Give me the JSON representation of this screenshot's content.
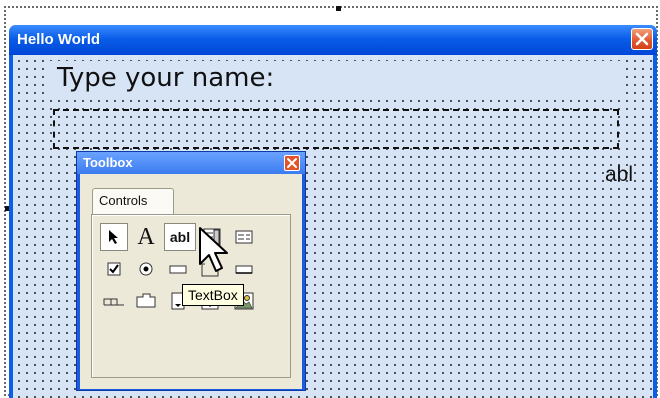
{
  "form": {
    "title": "Hello World",
    "label_text": "Type your name:",
    "ghost_text": "abl"
  },
  "toolbox": {
    "title": "Toolbox",
    "tab_label": "Controls",
    "tools": [
      "pointer-icon",
      "label-icon",
      "textbox-icon",
      "combobox-icon",
      "listbox-icon",
      "checkbox-icon",
      "optionbutton-icon",
      "togglebutton-icon",
      "frame-icon",
      "commandbutton-icon",
      "tabstrip-icon",
      "multipage-icon",
      "scrollbar-icon",
      "spinbutton-icon",
      "image-icon"
    ],
    "textbox_label": "abl",
    "label_glyph": "A"
  },
  "tooltip": {
    "text": "TextBox"
  },
  "colors": {
    "titlebar": "#0a5ee8",
    "client": "#d6e4f5",
    "close": "#e2542b",
    "toolbox_face": "#ece9d8",
    "tooltip_bg": "#ffffe1"
  }
}
